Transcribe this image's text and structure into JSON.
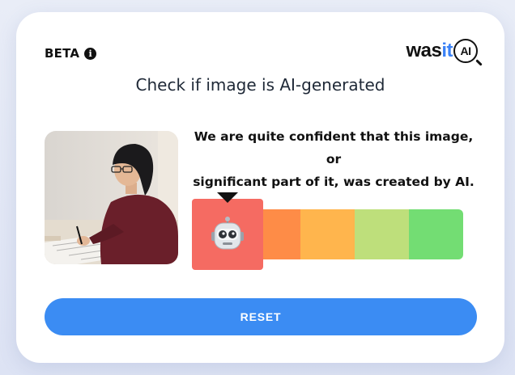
{
  "header": {
    "beta_label": "BETA",
    "info_icon": "info-icon",
    "logo": {
      "part1": "was",
      "part2": "it",
      "part3": "AI"
    }
  },
  "title": "Check if image is AI-generated",
  "result": {
    "message_line1": "We are quite confident that this image, or",
    "message_line2": "significant part of it, was created by AI."
  },
  "scale": {
    "colors": [
      "#f56b62",
      "#fe8c47",
      "#ffb54d",
      "#bedf7b",
      "#73dd73"
    ],
    "selected_index": 0,
    "marker_icon": "robot-icon",
    "marker_color": "#f56b62"
  },
  "buttons": {
    "reset_label": "RESET"
  },
  "colors": {
    "accent": "#3b8cf3",
    "logo_accent": "#3b82f6"
  }
}
